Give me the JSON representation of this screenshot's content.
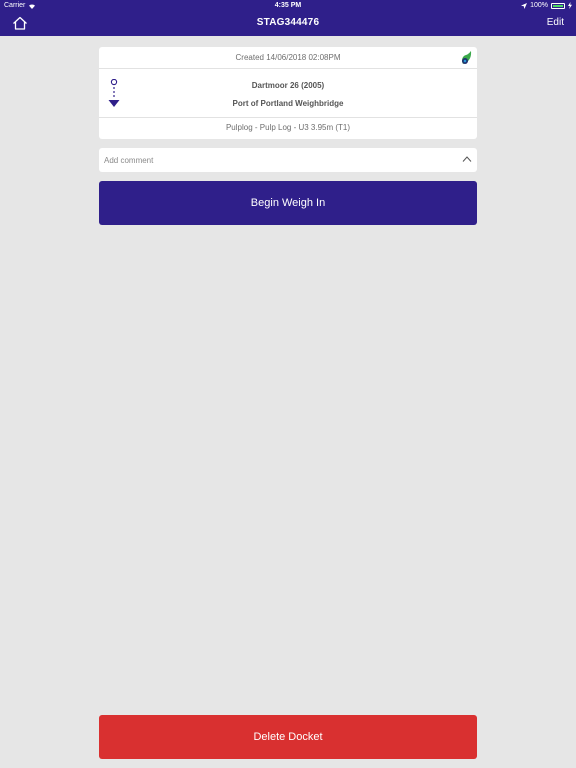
{
  "status_bar": {
    "carrier": "Carrier",
    "time": "4:35 PM",
    "battery": "100%"
  },
  "nav": {
    "title": "STAG344476",
    "edit_label": "Edit",
    "home_icon": "home-icon"
  },
  "docket": {
    "created": "Created 14/06/2018 02:08PM",
    "origin": "Dartmoor 26 (2005)",
    "destination": "Port of Portland Weighbridge",
    "product": "Pulplog - Pulp Log - U3 3.95m (T1)"
  },
  "comment": {
    "placeholder": "Add comment"
  },
  "actions": {
    "begin_label": "Begin Weigh In",
    "delete_label": "Delete Docket"
  },
  "colors": {
    "primary": "#2f1f8a",
    "danger": "#d93030",
    "background": "#e6e6e6"
  }
}
